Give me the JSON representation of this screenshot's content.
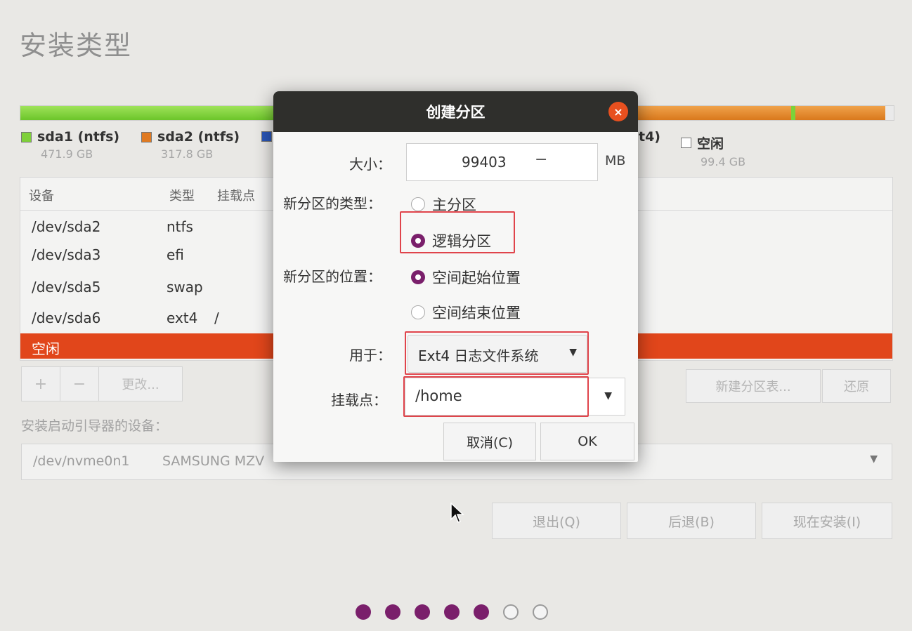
{
  "window": {
    "title": "安装类型"
  },
  "partition_bar": {
    "legend": [
      {
        "name": "sda1 (ntfs)",
        "size": "471.9 GB",
        "color": "#7fd03a"
      },
      {
        "name": "sda2 (ntfs)",
        "size": "317.8 GB",
        "color": "#e07a22"
      },
      {
        "name": "",
        "size": "",
        "color": "#2a56b8"
      },
      {
        "name": "t4)",
        "size": "",
        "color": "#e07a22"
      },
      {
        "name": "空闲",
        "size": "99.4 GB",
        "color": "#ffffff"
      }
    ]
  },
  "table": {
    "headers": [
      "设备",
      "类型",
      "挂载点"
    ],
    "rows": [
      {
        "device": "/dev/sda2",
        "type": "ntfs",
        "mount": ""
      },
      {
        "device": "/dev/sda3",
        "type": "efi",
        "mount": ""
      },
      {
        "device": "/dev/sda5",
        "type": "swap",
        "mount": ""
      },
      {
        "device": "/dev/sda6",
        "type": "ext4",
        "mount": "/"
      },
      {
        "device": "空闲",
        "type": "",
        "mount": ""
      }
    ]
  },
  "toolbar": {
    "add": "+",
    "remove": "−",
    "change": "更改...",
    "new_table": "新建分区表...",
    "revert": "还原"
  },
  "boot": {
    "label": "安装启动引导器的设备：",
    "device": "/dev/nvme0n1",
    "model": "SAMSUNG MZV"
  },
  "nav": {
    "quit": "退出(Q)",
    "back": "后退(B)",
    "install": "现在安装(I)"
  },
  "progress": {
    "total": 7,
    "done": 5,
    "active_color": "#7a1f6b"
  },
  "dialog": {
    "title": "创建分区",
    "close_icon": "×",
    "size_label": "大小：",
    "size_value": "99403",
    "size_minus": "−",
    "size_unit": "MB",
    "type_label": "新分区的类型：",
    "type_primary": "主分区",
    "type_logical": "逻辑分区",
    "location_label": "新分区的位置：",
    "location_start": "空间起始位置",
    "location_end": "空间结束位置",
    "use_label": "用于：",
    "use_value": "Ext4 日志文件系统",
    "mount_label": "挂载点：",
    "mount_value": "/home",
    "cancel": "取消(C)",
    "ok": "OK",
    "highlight_color": "#e0444b"
  }
}
